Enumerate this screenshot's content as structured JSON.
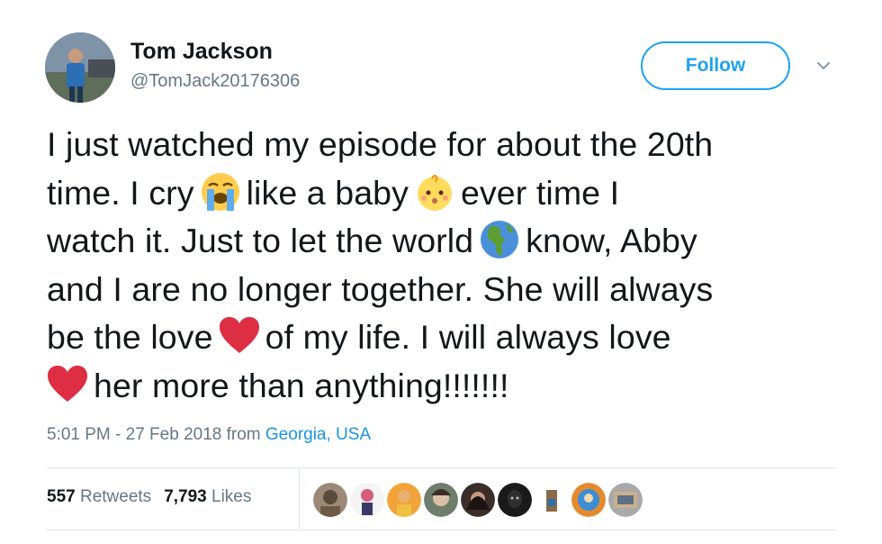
{
  "author": {
    "display_name": "Tom Jackson",
    "handle": "@TomJack20176306",
    "avatar_icon": "user-avatar"
  },
  "follow_label": "Follow",
  "tweet": {
    "lines": [
      {
        "parts": [
          "I just watched my episode for about the 20th"
        ]
      },
      {
        "parts": [
          "time. I cry",
          "like a baby",
          "ever time I"
        ],
        "emojis": [
          "loudly-crying-face-emoji",
          "baby-face-emoji"
        ]
      },
      {
        "parts": [
          "watch it. Just to let the world",
          "know, Abby"
        ],
        "emojis": [
          "globe-americas-emoji"
        ]
      },
      {
        "parts": [
          "and I are no longer together. She will always"
        ]
      },
      {
        "parts": [
          "be the love",
          "of my life. I will always love"
        ],
        "emojis": [
          "red-heart-emoji"
        ]
      },
      {
        "parts": [
          "",
          "her more than anything!!!!!!!"
        ],
        "emojis": [
          "red-heart-emoji"
        ]
      }
    ]
  },
  "meta": {
    "time": "5:01 PM - 27 Feb 2018 from",
    "location": "Georgia, USA"
  },
  "stats": {
    "retweets_count": "557",
    "retweets_label": "Retweets",
    "likes_count": "7,793",
    "likes_label": "Likes"
  },
  "likers": [
    {
      "icon": "liker-avatar-1",
      "color": "#9b8a78"
    },
    {
      "icon": "liker-avatar-2",
      "color": "#f4f4f4"
    },
    {
      "icon": "liker-avatar-3",
      "color": "#f2a33a"
    },
    {
      "icon": "liker-avatar-4",
      "color": "#6f7d6c"
    },
    {
      "icon": "liker-avatar-5",
      "color": "#3b2e2a"
    },
    {
      "icon": "liker-avatar-6",
      "color": "#1a1a1a"
    },
    {
      "icon": "liker-avatar-7",
      "color": "#ffffff"
    },
    {
      "icon": "liker-avatar-8",
      "color": "#e38a2f"
    },
    {
      "icon": "liker-avatar-9",
      "color": "#a9a9a9"
    }
  ],
  "colors": {
    "accent": "#1da1f2",
    "link": "#1b95e0",
    "muted": "#657786",
    "heart": "#e0112b"
  }
}
